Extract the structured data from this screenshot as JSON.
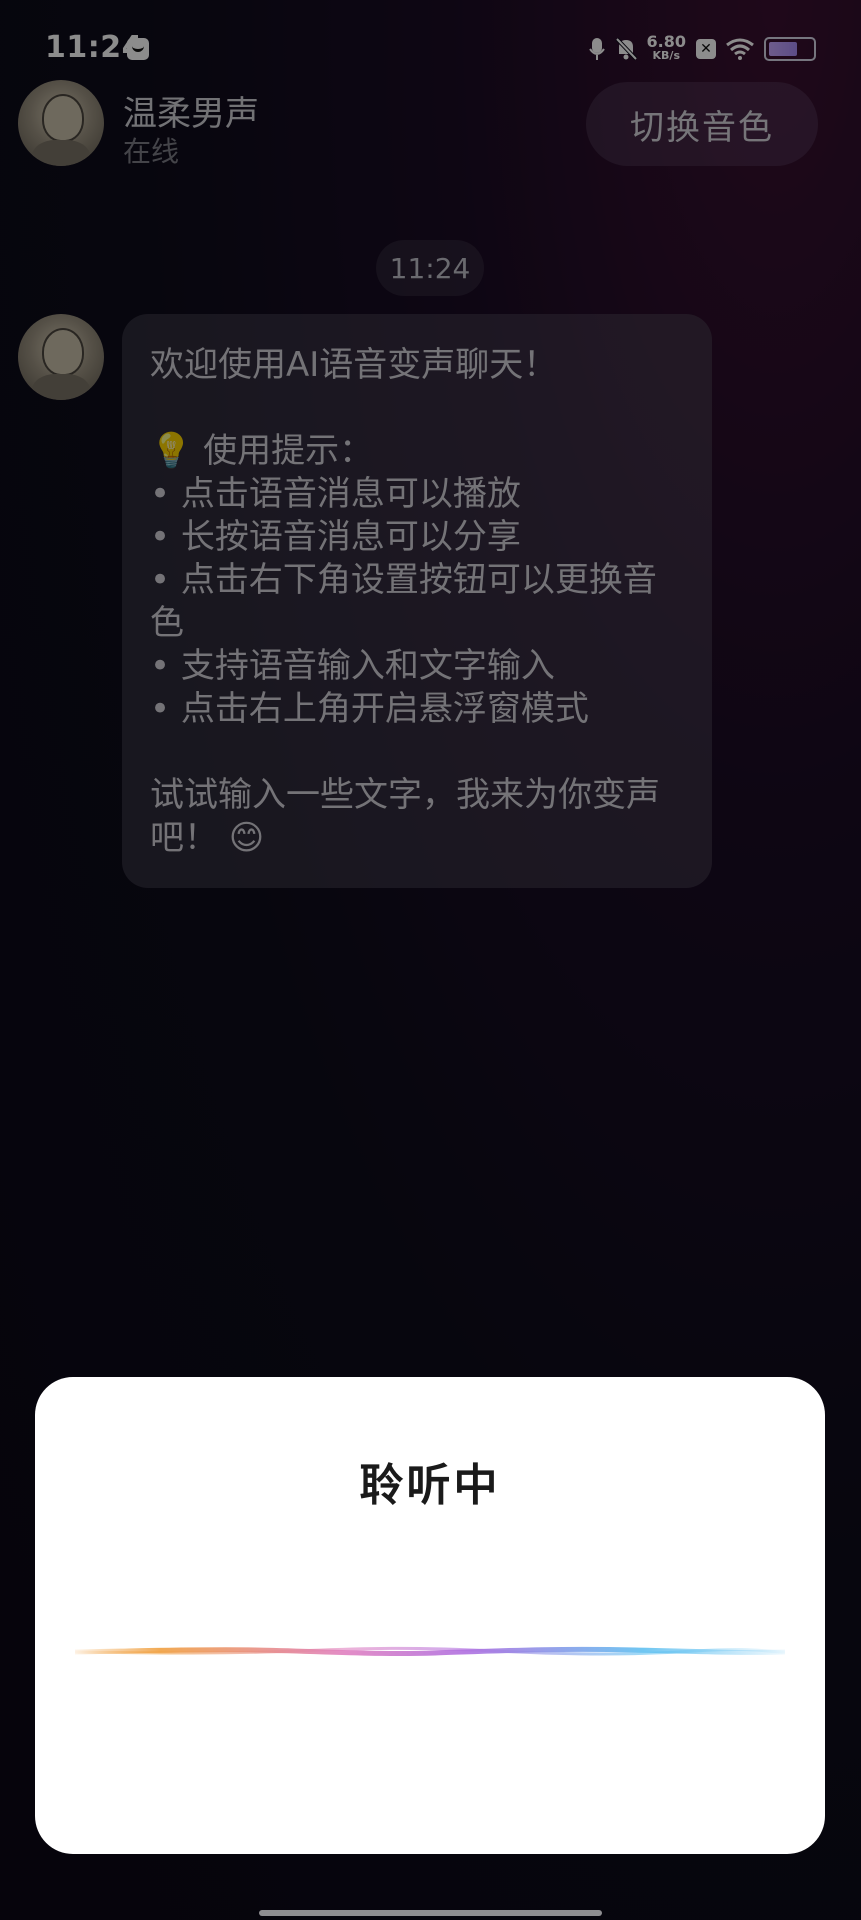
{
  "status_bar": {
    "time": "11:24",
    "net_speed_value": "6.80",
    "net_speed_unit": "KB/s",
    "icons": [
      "mail-icon",
      "mic-icon",
      "mute-bell-icon",
      "close-app-icon",
      "wifi-icon",
      "battery-icon"
    ],
    "battery_level": 0.7
  },
  "header": {
    "contact_name": "温柔男声",
    "contact_status": "在线",
    "switch_voice_label": "切换音色"
  },
  "chat": {
    "time_label": "11:24",
    "messages": [
      {
        "sender": "contact",
        "lines": [
          "欢迎使用AI语音变声聊天！",
          "",
          "💡 使用提示：",
          "• 点击语音消息可以播放",
          "• 长按语音消息可以分享",
          "• 点击右下角设置按钮可以更换音色",
          "• 支持语音输入和文字输入",
          "• 点击右上角开启悬浮窗模式",
          "",
          "试试输入一些文字，我来为你变声吧！ 😊"
        ]
      }
    ]
  },
  "listening_sheet": {
    "title": "聆听中",
    "wave_colors": [
      "#f0a040",
      "#e080c0",
      "#b070e0",
      "#60c0f0"
    ]
  },
  "colors": {
    "sheet_bg": "#ffffff",
    "page_bg": "#0d0b1a"
  }
}
